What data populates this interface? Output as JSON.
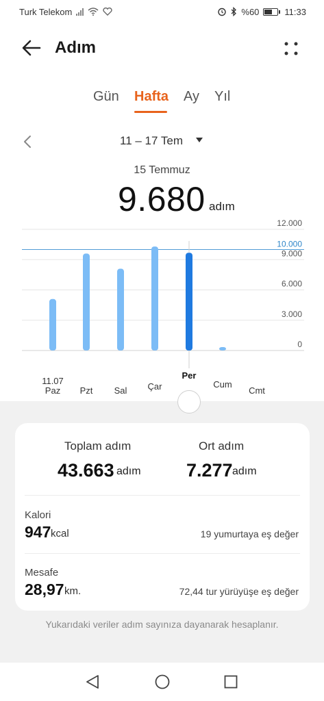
{
  "status_bar": {
    "carrier": "Turk Telekom",
    "battery_text": "%60",
    "battery_level": 0.6,
    "time": "11:33",
    "icons": [
      "signal-icon",
      "wifi-icon",
      "heart-icon",
      "alarm-icon",
      "bluetooth-icon",
      "battery-icon"
    ]
  },
  "header": {
    "title": "Adım"
  },
  "tabs": [
    {
      "label": "Gün",
      "active": false
    },
    {
      "label": "Hafta",
      "active": true
    },
    {
      "label": "Ay",
      "active": false
    },
    {
      "label": "Yıl",
      "active": false
    }
  ],
  "date_range": {
    "label": "11 – 17 Tem"
  },
  "selected": {
    "date": "15 Temmuz",
    "value": "9.680",
    "unit": "adım"
  },
  "chart_data": {
    "type": "bar",
    "categories": [
      "Paz",
      "Pzt",
      "Sal",
      "Çar",
      "Per",
      "Cum",
      "Cmt"
    ],
    "first_date_label": "11.07",
    "values": [
      5100,
      9600,
      8100,
      10300,
      9680,
      250,
      0
    ],
    "selected_index": 4,
    "goal": 10000,
    "goal_label": "10.000",
    "y_ticks": [
      "12.000",
      "9.000",
      "6.000",
      "3.000",
      "0"
    ],
    "y_tick_values": [
      12000,
      9000,
      6000,
      3000,
      0
    ],
    "ylim": [
      0,
      12000
    ],
    "grid": true,
    "colors": {
      "bar": "#7cbcf6",
      "bar_selected": "#1f7ae0",
      "goal_line": "#4f9bd6",
      "goal_label": "#2f86c9"
    }
  },
  "summary": {
    "total_label": "Toplam adım",
    "total_value": "43.663",
    "total_unit": "adım",
    "avg_label": "Ort adım",
    "avg_value": "7.277",
    "avg_unit": "adım",
    "calorie_label": "Kalori",
    "calorie_value": "947",
    "calorie_unit": "kcal",
    "calorie_equiv": "19 yumurtaya eş değer",
    "distance_label": "Mesafe",
    "distance_value": "28,97",
    "distance_unit": "km.",
    "distance_equiv": "72,44 tur yürüyüşe eş değer"
  },
  "footnote": "Yukarıdaki veriler adım sayınıza dayanarak hesaplanır.",
  "nav_bar": {
    "buttons": [
      "back-triangle-icon",
      "home-circle-icon",
      "recents-square-icon"
    ]
  }
}
